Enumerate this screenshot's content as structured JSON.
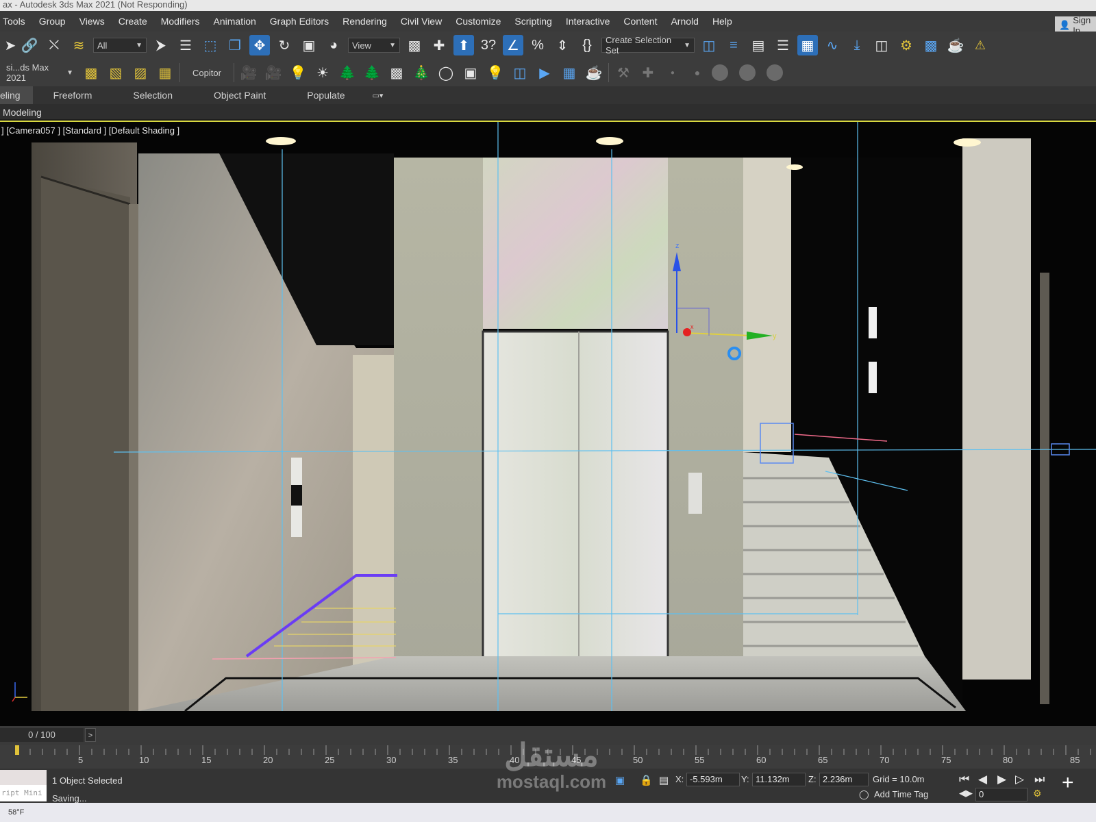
{
  "window": {
    "title": "ax - Autodesk 3ds Max 2021  (Not Responding)",
    "sign_in": "Sign In"
  },
  "menu": [
    "Tools",
    "Group",
    "Views",
    "Create",
    "Modifiers",
    "Animation",
    "Graph Editors",
    "Rendering",
    "Civil View",
    "Customize",
    "Scripting",
    "Interactive",
    "Content",
    "Arnold",
    "Help"
  ],
  "toolbar": {
    "selection_filter": "All",
    "reference_coord": "View",
    "snap_label": "3",
    "named_selection": "Create Selection Set",
    "workspace": "si...ds Max 2021",
    "copitor": "Copitor"
  },
  "ribbon": {
    "tabs": [
      "eling",
      "Freeform",
      "Selection",
      "Object Paint",
      "Populate"
    ],
    "sub_tab": "Modeling"
  },
  "viewport": {
    "label": "] [Camera057 ] [Standard ] [Default Shading ]",
    "gizmo_axes": {
      "z": "z",
      "y": "y",
      "x": "x"
    }
  },
  "timeline": {
    "frame": "0 / 100",
    "next": ">",
    "ticks": [
      "5",
      "10",
      "15",
      "20",
      "25",
      "30",
      "35",
      "40",
      "45",
      "50",
      "55",
      "60",
      "65",
      "70",
      "75",
      "80",
      "85"
    ]
  },
  "status": {
    "selection": "1 Object Selected",
    "message": "Saving...",
    "mini_listener": "ript Mini",
    "x_label": "X:",
    "x": "-5.593m",
    "y_label": "Y:",
    "y": "11.132m",
    "z_label": "Z:",
    "z": "2.236m",
    "grid": "Grid = 10.0m",
    "add_time_tag": "Add Time Tag",
    "current_frame": "0"
  },
  "taskbar": {
    "weather": "58°F"
  },
  "watermark": {
    "arabic": "مستقل",
    "latin": "mostaql.com"
  },
  "colors": {
    "accent": "#2d6fb8",
    "viewport_border": "#d8d840",
    "icon_blue": "#5aa7f5"
  }
}
